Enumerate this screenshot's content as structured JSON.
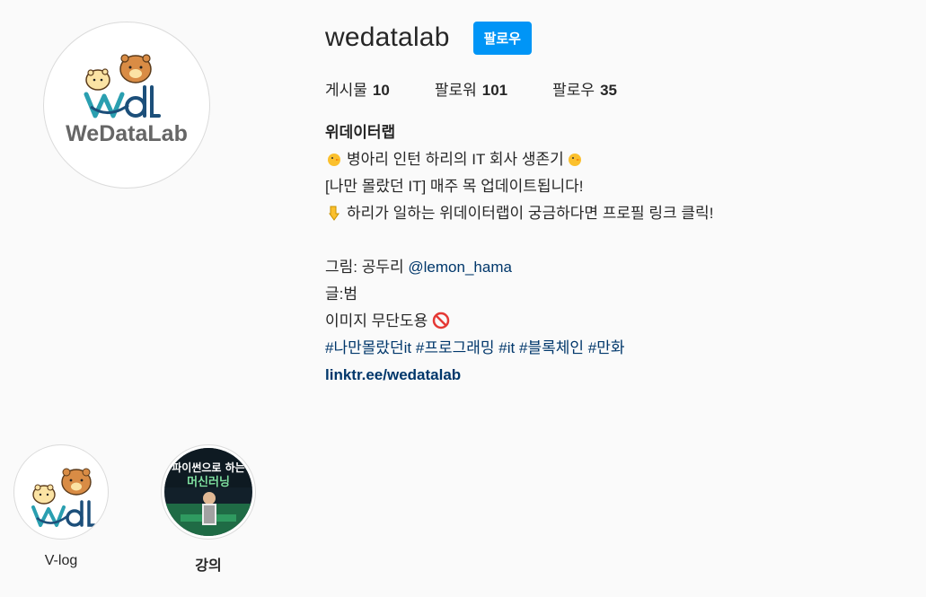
{
  "profile": {
    "username": "wedatalab",
    "follow_button": "팔로우",
    "avatar_logo_text": "WeDataLab",
    "stats": [
      {
        "label": "게시물",
        "value": "10"
      },
      {
        "label": "팔로워",
        "value": "101"
      },
      {
        "label": "팔로우",
        "value": "35"
      }
    ]
  },
  "bio": {
    "name": "위데이터랩",
    "line1": "병아리 인턴 하리의 IT 회사 생존기",
    "line2": "[나만 몰랐던 IT] 매주 목 업데이트됩니다!",
    "line3": "하리가 일하는 위데이터랩이 궁금하다면 프로필 링크 클릭!",
    "credit_label": "그림: 공두리",
    "credit_mention": "@lemon_hama",
    "writer": "글:범",
    "no_copy": "이미지 무단도용",
    "hashtags": [
      "#나만몰랐던it",
      "#프로그래밍",
      "#it",
      "#블록체인",
      "#만화"
    ],
    "link": "linktr.ee/wedatalab"
  },
  "highlights": [
    {
      "label": "V-log",
      "icon": "wd-logo-bears"
    },
    {
      "label": "강의",
      "icon": "lecture-photo",
      "thumb_text_1": "파이썬으로 하는",
      "thumb_text_2": "머신러닝"
    }
  ],
  "colors": {
    "accent": "#0095f6",
    "link": "#00376b",
    "background": "#fafafa"
  }
}
